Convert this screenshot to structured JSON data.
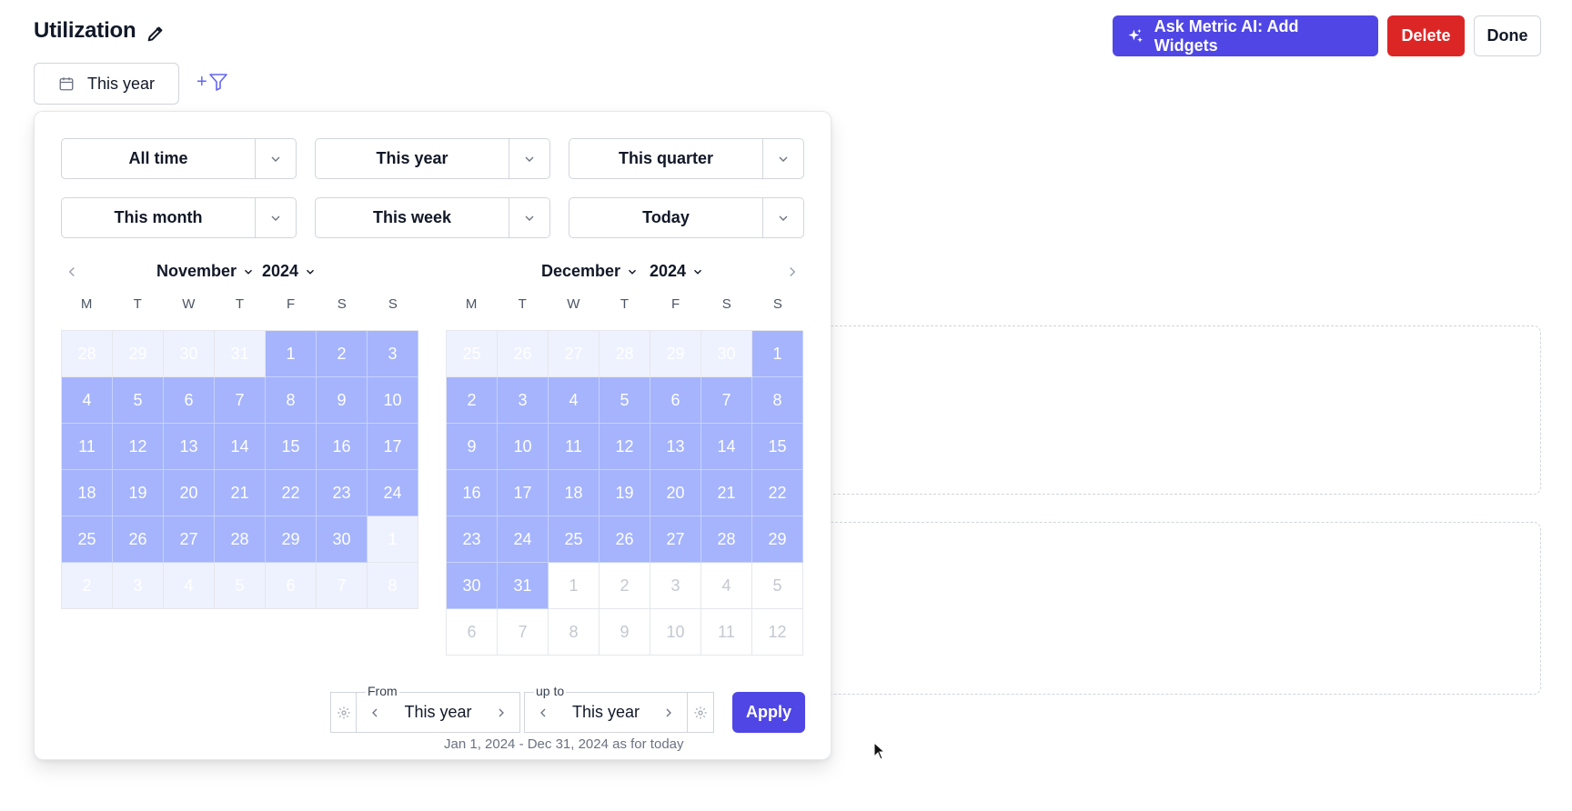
{
  "header": {
    "title": "Utilization",
    "ai_button": "Ask Metric AI: Add Widgets",
    "delete_button": "Delete",
    "done_button": "Done"
  },
  "filter_bar": {
    "period_label": "This year",
    "add_filter": "+"
  },
  "presets": [
    {
      "label": "All time"
    },
    {
      "label": "This year"
    },
    {
      "label": "This quarter"
    },
    {
      "label": "This month"
    },
    {
      "label": "This week"
    },
    {
      "label": "Today"
    }
  ],
  "calendars": [
    {
      "month": "November",
      "year": "2024",
      "weekdays": [
        "M",
        "T",
        "W",
        "T",
        "F",
        "S",
        "S"
      ],
      "days": [
        "28",
        "29",
        "30",
        "31",
        "1",
        "2",
        "3",
        "4",
        "5",
        "6",
        "7",
        "8",
        "9",
        "10",
        "11",
        "12",
        "13",
        "14",
        "15",
        "16",
        "17",
        "18",
        "19",
        "20",
        "21",
        "22",
        "23",
        "24",
        "25",
        "26",
        "27",
        "28",
        "29",
        "30",
        "1",
        "2",
        "3",
        "4",
        "5",
        "6",
        "7",
        "8"
      ],
      "states": [
        "selout",
        "selout",
        "selout",
        "selout",
        "sel",
        "sel",
        "sel",
        "sel",
        "sel",
        "sel",
        "sel",
        "sel",
        "sel",
        "sel",
        "sel",
        "sel",
        "sel",
        "sel",
        "sel",
        "sel",
        "sel",
        "sel",
        "sel",
        "sel",
        "sel",
        "sel",
        "sel",
        "sel",
        "sel",
        "sel",
        "sel",
        "sel",
        "sel",
        "sel",
        "selout",
        "selout",
        "selout",
        "selout",
        "selout",
        "selout",
        "selout",
        "selout"
      ]
    },
    {
      "month": "December",
      "year": "2024",
      "weekdays": [
        "M",
        "T",
        "W",
        "T",
        "F",
        "S",
        "S"
      ],
      "days": [
        "25",
        "26",
        "27",
        "28",
        "29",
        "30",
        "1",
        "2",
        "3",
        "4",
        "5",
        "6",
        "7",
        "8",
        "9",
        "10",
        "11",
        "12",
        "13",
        "14",
        "15",
        "16",
        "17",
        "18",
        "19",
        "20",
        "21",
        "22",
        "23",
        "24",
        "25",
        "26",
        "27",
        "28",
        "29",
        "30",
        "31",
        "1",
        "2",
        "3",
        "4",
        "5",
        "6",
        "7",
        "8",
        "9",
        "10",
        "11",
        "12"
      ],
      "states": [
        "selout",
        "selout",
        "selout",
        "selout",
        "selout",
        "selout",
        "sel",
        "sel",
        "sel",
        "sel",
        "sel",
        "sel",
        "sel",
        "sel",
        "sel",
        "sel",
        "sel",
        "sel",
        "sel",
        "sel",
        "sel",
        "sel",
        "sel",
        "sel",
        "sel",
        "sel",
        "sel",
        "sel",
        "sel",
        "sel",
        "sel",
        "sel",
        "sel",
        "sel",
        "sel",
        "sel",
        "sel",
        "out",
        "out",
        "out",
        "out",
        "out",
        "out",
        "out",
        "out",
        "out",
        "out",
        "out",
        "out"
      ]
    }
  ],
  "range": {
    "from_legend": "From",
    "from_value": "This year",
    "to_legend": "up to",
    "to_value": "This year",
    "apply": "Apply",
    "note": "Jan 1, 2024 - Dec 31, 2024 as for today"
  },
  "colors": {
    "accent": "#4f46e5",
    "danger": "#dc2626",
    "selected_day": "#a5b4fc",
    "selected_outside": "#eef2ff"
  }
}
